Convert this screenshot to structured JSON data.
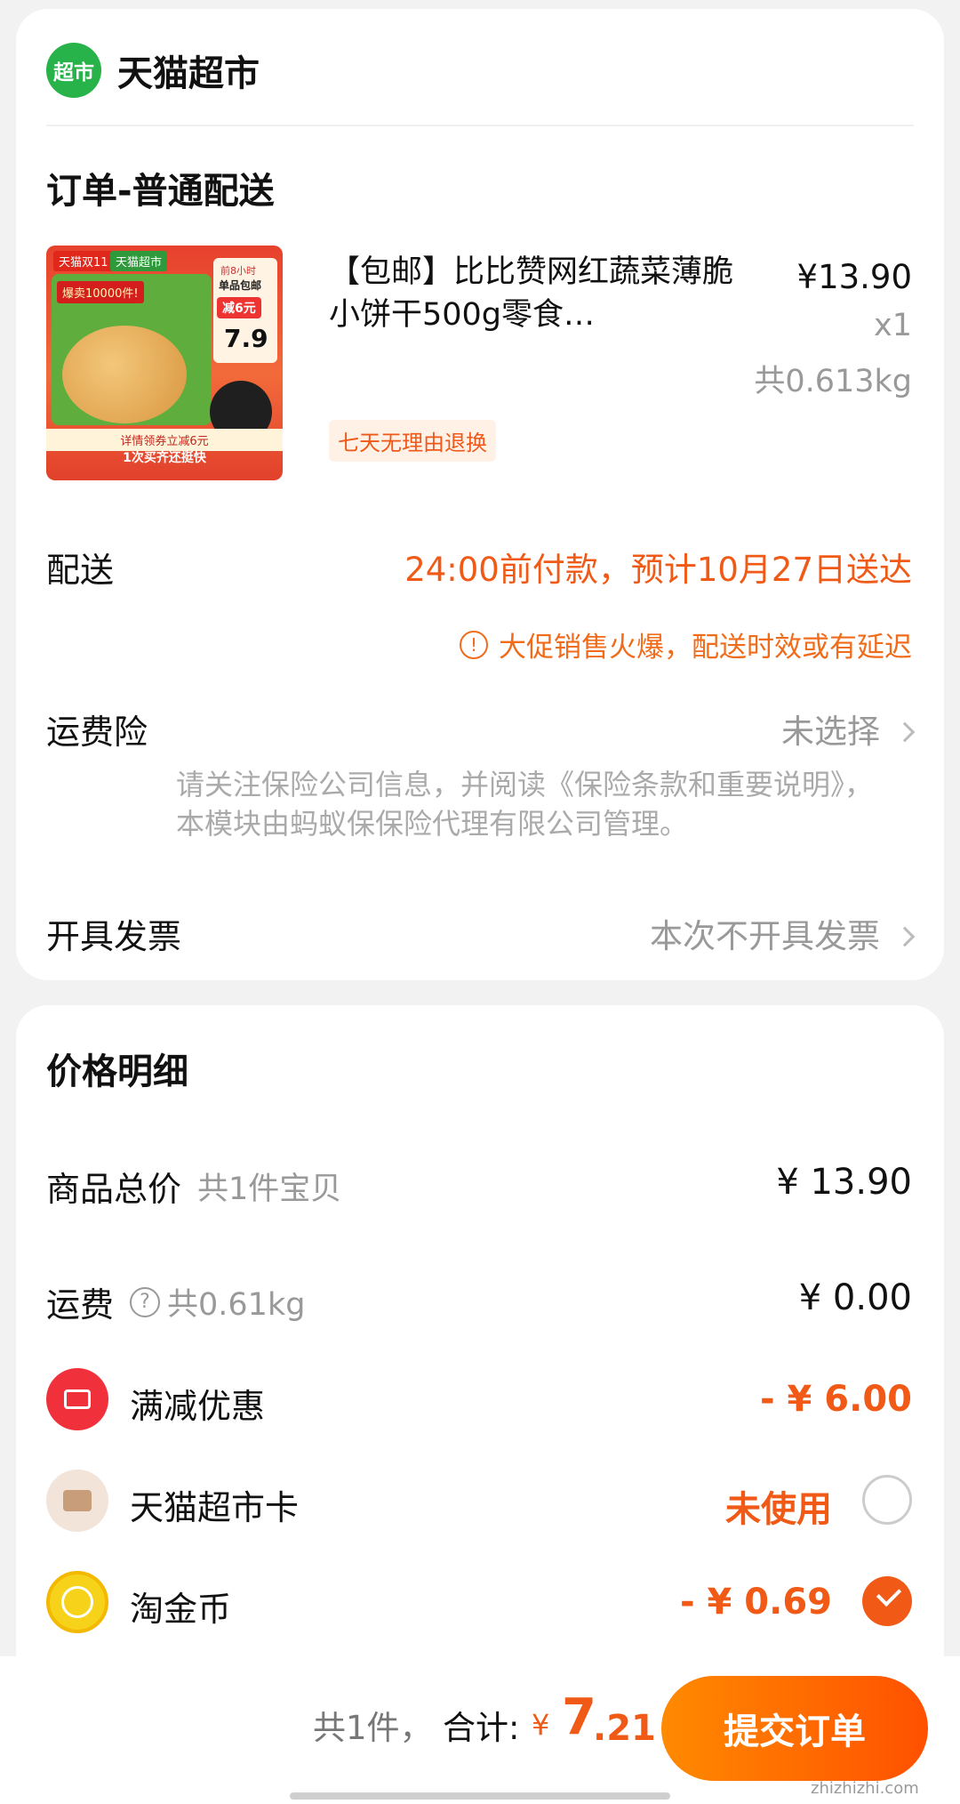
{
  "store": {
    "logo_text": "超市",
    "name": "天猫超市"
  },
  "order": {
    "section_title": "订单-普通配送",
    "product": {
      "title": "【包邮】比比赞网红蔬菜薄脆小饼干500g零食…",
      "price": "¥13.90",
      "qty": "x1",
      "weight": "共0.613kg",
      "tag": "七天无理由退换",
      "image": {
        "tag1": "天猫双11",
        "tag2": "天猫超市",
        "hot": "爆卖10000件!",
        "promo1": "前8小时",
        "promo2": "单品包邮",
        "promo3": "减6元",
        "promo_price": "7.9",
        "bottom1": "详情领券立减6元",
        "bottom2": "1次买齐还挺快"
      }
    },
    "delivery": {
      "label": "配送",
      "value": "24:00前付款，预计10月27日送达",
      "warning": "大促销售火爆，配送时效或有延迟"
    },
    "insurance": {
      "label": "运费险",
      "value": "未选择",
      "note": "请关注保险公司信息，并阅读《保险条款和重要说明》，本模块由蚂蚁保保险代理有限公司管理。"
    },
    "invoice": {
      "label": "开具发票",
      "value": "本次不开具发票"
    }
  },
  "price_detail": {
    "title": "价格明细",
    "goods_total": {
      "label": "商品总价",
      "sub": "共1件宝贝",
      "value": "¥ 13.90"
    },
    "shipping": {
      "label": "运费",
      "sub": "共0.61kg",
      "value": "¥ 0.00"
    },
    "discount": {
      "label": "满减优惠",
      "value": "- ¥ 6.00"
    },
    "card": {
      "label": "天猫超市卡",
      "value": "未使用"
    },
    "coins": {
      "label": "淘金币",
      "value": "- ¥ 0.69"
    }
  },
  "footer": {
    "count": "共1件，",
    "total_label": "合计:",
    "yen": "¥",
    "total_int": "7",
    "total_dec": ".21",
    "submit": "提交订单",
    "watermark": "zhizhizhi.com"
  },
  "colors": {
    "accent": "#f05a16",
    "brand_green": "#27b24a"
  },
  "icons": [
    "warning-icon",
    "chevron-right-icon",
    "help-icon",
    "coupon-icon",
    "card-icon",
    "coin-icon",
    "check-icon"
  ]
}
